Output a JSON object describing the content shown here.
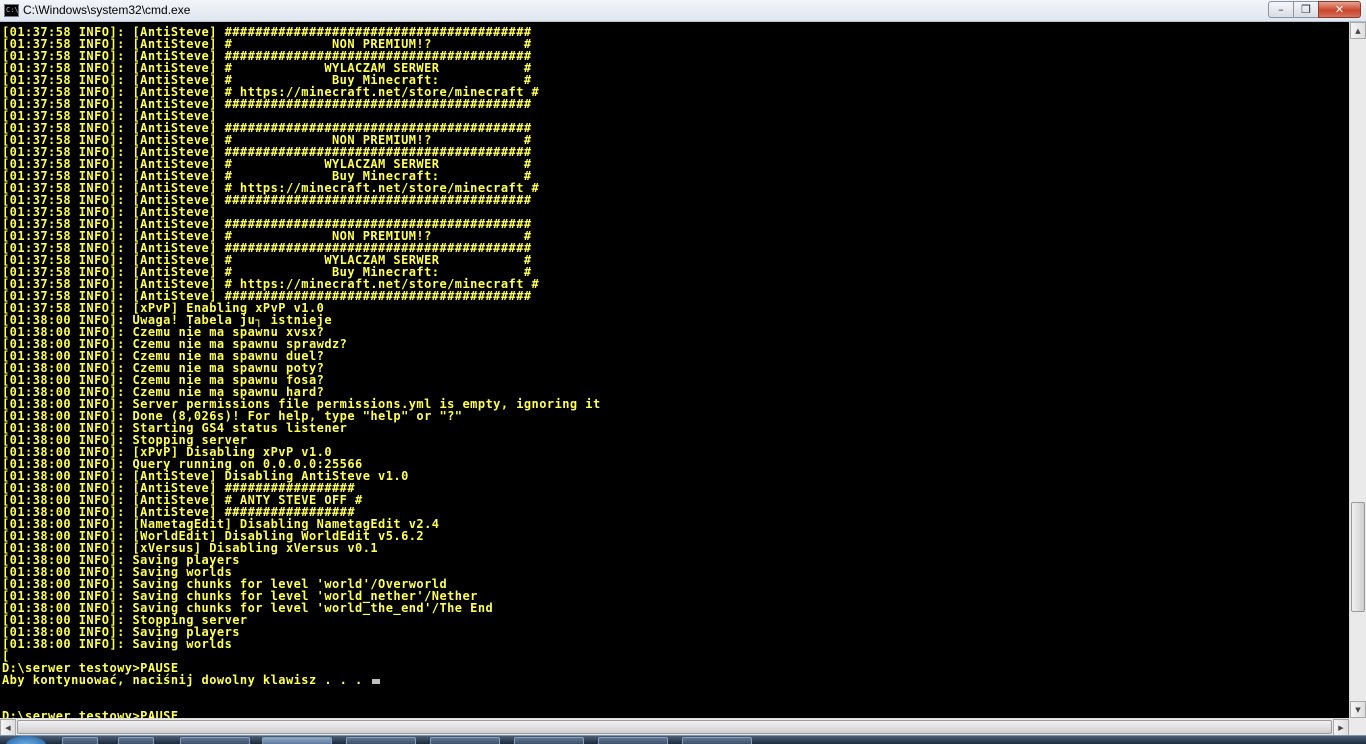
{
  "window": {
    "title": "C:\\Windows\\system32\\cmd.exe",
    "icon": "cmd-icon",
    "icon_glyph": "C:\\",
    "minimize_glyph": "–",
    "maximize_glyph": "❐",
    "close_glyph": "✕"
  },
  "console": {
    "text_color": "#ffff55",
    "background": "#000000",
    "lines": [
      "[01:37:58 INFO]: [AntiSteve] ########################################",
      "[01:37:58 INFO]: [AntiSteve] #             NON PREMIUM!?            #",
      "[01:37:58 INFO]: [AntiSteve] ########################################",
      "[01:37:58 INFO]: [AntiSteve] #            WYLACZAM SERWER           #",
      "[01:37:58 INFO]: [AntiSteve] #             Buy Minecraft:           #",
      "[01:37:58 INFO]: [AntiSteve] # https://minecraft.net/store/minecraft #",
      "[01:37:58 INFO]: [AntiSteve] ########################################",
      "[01:37:58 INFO]: [AntiSteve]",
      "[01:37:58 INFO]: [AntiSteve] ########################################",
      "[01:37:58 INFO]: [AntiSteve] #             NON PREMIUM!?            #",
      "[01:37:58 INFO]: [AntiSteve] ########################################",
      "[01:37:58 INFO]: [AntiSteve] #            WYLACZAM SERWER           #",
      "[01:37:58 INFO]: [AntiSteve] #             Buy Minecraft:           #",
      "[01:37:58 INFO]: [AntiSteve] # https://minecraft.net/store/minecraft #",
      "[01:37:58 INFO]: [AntiSteve] ########################################",
      "[01:37:58 INFO]: [AntiSteve]",
      "[01:37:58 INFO]: [AntiSteve] ########################################",
      "[01:37:58 INFO]: [AntiSteve] #             NON PREMIUM!?            #",
      "[01:37:58 INFO]: [AntiSteve] ########################################",
      "[01:37:58 INFO]: [AntiSteve] #            WYLACZAM SERWER           #",
      "[01:37:58 INFO]: [AntiSteve] #             Buy Minecraft:           #",
      "[01:37:58 INFO]: [AntiSteve] # https://minecraft.net/store/minecraft #",
      "[01:37:58 INFO]: [AntiSteve] ########################################",
      "[01:37:58 INFO]: [xPvP] Enabling xPvP v1.0",
      "[01:38:00 INFO]: Uwaga! Tabela ju┐ istnieje",
      "[01:38:00 INFO]: Czemu nie ma spawnu xvsx?",
      "[01:38:00 INFO]: Czemu nie ma spawnu sprawdz?",
      "[01:38:00 INFO]: Czemu nie ma spawnu duel?",
      "[01:38:00 INFO]: Czemu nie ma spawnu poty?",
      "[01:38:00 INFO]: Czemu nie ma spawnu fosa?",
      "[01:38:00 INFO]: Czemu nie ma spawnu hard?",
      "[01:38:00 INFO]: Server permissions file permissions.yml is empty, ignoring it",
      "[01:38:00 INFO]: Done (8,026s)! For help, type \"help\" or \"?\"",
      "[01:38:00 INFO]: Starting GS4 status listener",
      "[01:38:00 INFO]: Stopping server",
      "[01:38:00 INFO]: [xPvP] Disabling xPvP v1.0",
      "[01:38:00 INFO]: Query running on 0.0.0.0:25566",
      "[01:38:00 INFO]: [AntiSteve] Disabling AntiSteve v1.0",
      "[01:38:00 INFO]: [AntiSteve] #################",
      "[01:38:00 INFO]: [AntiSteve] # ANTY STEVE OFF #",
      "[01:38:00 INFO]: [AntiSteve] #################",
      "[01:38:00 INFO]: [NametagEdit] Disabling NametagEdit v2.4",
      "[01:38:00 INFO]: [WorldEdit] Disabling WorldEdit v5.6.2",
      "[01:38:00 INFO]: [xVersus] Disabling xVersus v0.1",
      "[01:38:00 INFO]: Saving players",
      "[01:38:00 INFO]: Saving worlds",
      "[01:38:00 INFO]: Saving chunks for level 'world'/Overworld",
      "[01:38:00 INFO]: Saving chunks for level 'world_nether'/Nether",
      "[01:38:00 INFO]: Saving chunks for level 'world_the_end'/The End",
      "[01:38:00 INFO]: Stopping server",
      "[01:38:00 INFO]: Saving players",
      "[01:38:00 INFO]: Saving worlds",
      "[",
      "D:\\serwer testowy>PAUSE",
      "Aby kontynuować, naciśnij dowolny klawisz . . . ",
      "",
      "",
      "D:\\serwer testowy>PAUSE"
    ]
  },
  "scrollbars": {
    "up_arrow": "▲",
    "down_arrow": "▼",
    "left_arrow": "◀",
    "right_arrow": "▶"
  }
}
